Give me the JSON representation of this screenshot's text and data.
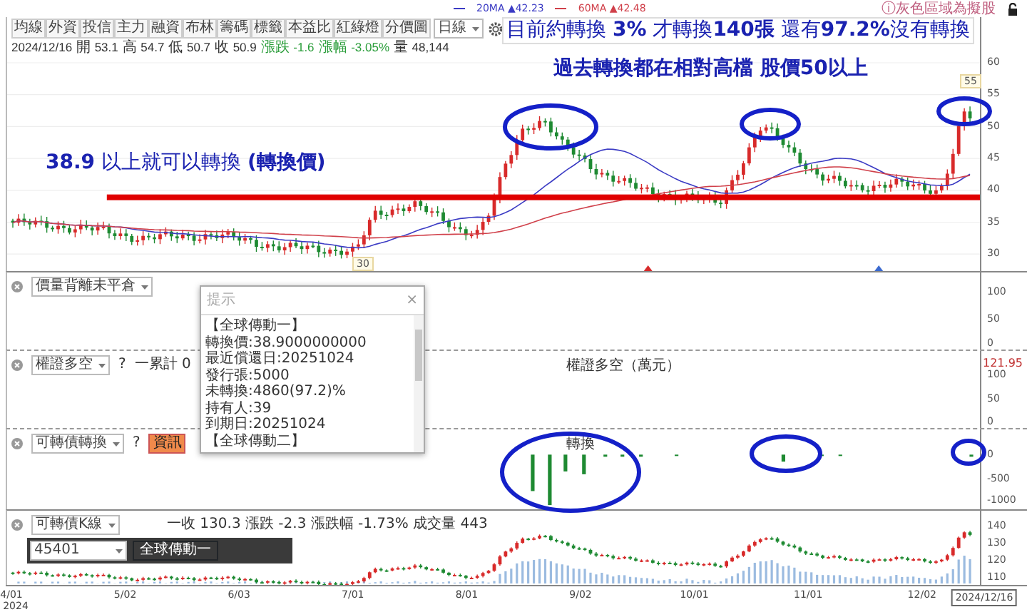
{
  "legend": [
    {
      "label": "20MA",
      "value": "▲42.23",
      "color": "#3b3bc4"
    },
    {
      "label": "60MA",
      "value": "▲42.48",
      "color": "#d0404a"
    }
  ],
  "notice": "ⓘ灰色區域為擬股",
  "toolbar": {
    "buttons": [
      "均線",
      "外資",
      "投信",
      "主力",
      "融資",
      "布林",
      "籌碼",
      "標籤",
      "本益比",
      "紅綠燈",
      "分價圖"
    ],
    "period": "日線"
  },
  "quote": [
    {
      "value": "2024/12/16",
      "kind": "plain"
    },
    {
      "label": "開",
      "value": "53.1",
      "kind": "plain"
    },
    {
      "label": "高",
      "value": "54.7",
      "kind": "plain"
    },
    {
      "label": "低",
      "value": "50.7",
      "kind": "plain"
    },
    {
      "label": "收",
      "value": "50.9",
      "kind": "plain"
    },
    {
      "label": "漲跌",
      "value": "-1.6",
      "kind": "change"
    },
    {
      "label": "漲幅",
      "value": "-3.05%",
      "kind": "change"
    },
    {
      "label": "量",
      "value": "48,144",
      "kind": "plain"
    }
  ],
  "main_chart": {
    "y_ticks": [
      "60",
      "55",
      "50",
      "45",
      "40",
      "35",
      "30"
    ],
    "high_label": "55",
    "low_label": "30"
  },
  "annotations": [
    {
      "text": "目前約轉換 **3%** 才轉換**140張** 還有**97.2%**沒有轉換"
    },
    {
      "text": "過去轉換都在相對高檔 股價50以上"
    },
    {
      "text": "**38.9** 以上就可以轉換 **(轉換價)**"
    }
  ],
  "panels": [
    {
      "indicator": "價量背離未平倉",
      "y_ticks": [
        "100",
        "50",
        "0"
      ]
    },
    {
      "indicator": "權證多空",
      "help": "?",
      "legend": "一累計 0",
      "series_label": "權證多空（萬元）",
      "last_value": "121.95",
      "y_ticks": [
        "100",
        "50",
        "0"
      ]
    },
    {
      "indicator": "可轉債轉換",
      "help": "?",
      "badge": "資訊",
      "series_label": "轉換",
      "y_ticks": [
        "0",
        "-500",
        "-1000"
      ]
    },
    {
      "indicator": "可轉債K線",
      "code": "45401",
      "bond_button": "全球傳動一",
      "legend": "一收 130.3 漲跌 -2.3 漲跌幅 -1.73% 成交量 443",
      "y_ticks": [
        "140",
        "130",
        "120",
        "110"
      ]
    }
  ],
  "popup": {
    "title": "提示",
    "close": "×",
    "lines": [
      "【全球傳動一】",
      "轉換價:38.9000000000",
      "最近償還日:20251024",
      "發行張:5000",
      "未轉換:4860(97.2)%",
      "持有人:39",
      "到期日:20251024",
      "【全球傳動二】"
    ]
  },
  "x_axis": [
    {
      "label": "4/01",
      "sub": "2024",
      "kind": "date"
    },
    {
      "label": "5/02",
      "kind": "date"
    },
    {
      "label": "6/03",
      "kind": "date"
    },
    {
      "label": "7/01",
      "kind": "date"
    },
    {
      "label": "8/01",
      "kind": "date"
    },
    {
      "label": "9/02",
      "kind": "date"
    },
    {
      "label": "10/01",
      "kind": "date"
    },
    {
      "label": "11/01",
      "kind": "date"
    },
    {
      "label": "12/02",
      "kind": "date"
    },
    {
      "label": "2024/12/16",
      "kind": "cursor"
    }
  ]
}
